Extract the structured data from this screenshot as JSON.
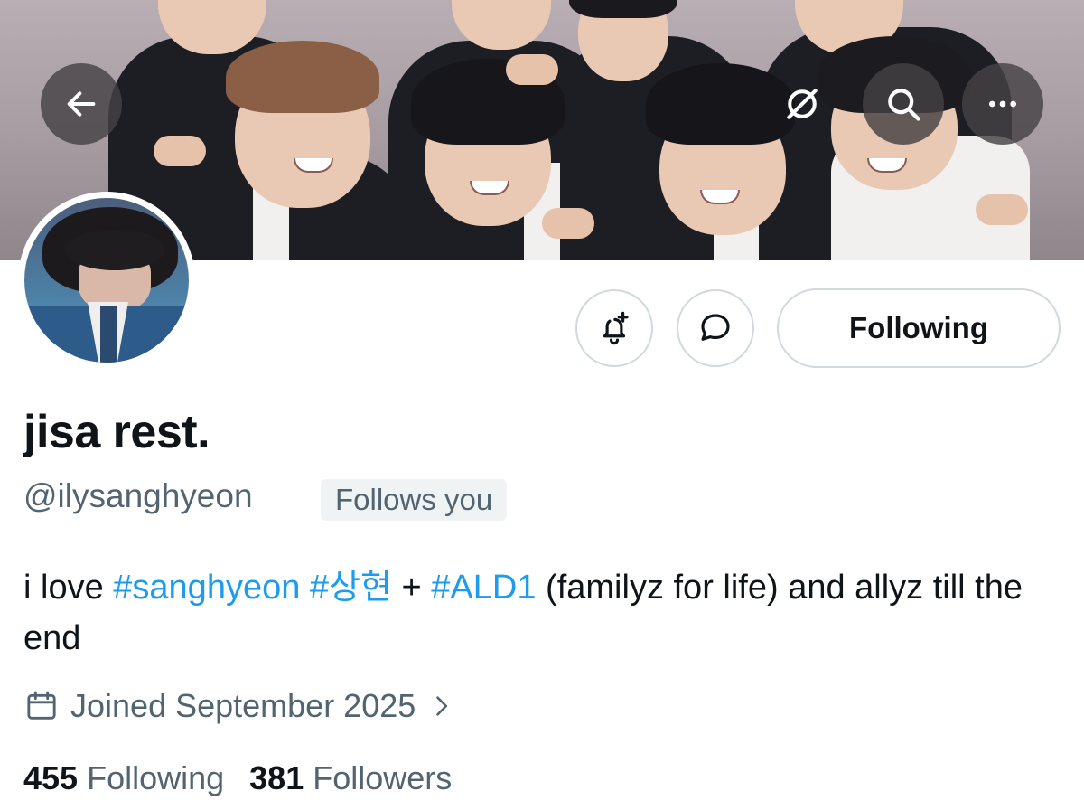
{
  "header": {
    "back_icon": "arrow-left-icon",
    "grok_icon": "slashed-circle-icon",
    "search_icon": "search-icon",
    "more_icon": "more-dots-icon"
  },
  "profile": {
    "display_name": "jisa rest.",
    "handle": "@ilysanghyeon",
    "follows_you": "Follows you",
    "bio": {
      "t1": "i love ",
      "tag1": "#sanghyeon",
      "t2": " ",
      "tag2": "#상현",
      "t3": " + ",
      "tag3": "#ALD1",
      "t4": " (familyz for life) and allyz till the end"
    },
    "joined": "Joined September 2025",
    "following_count": "455",
    "following_label": "Following",
    "followers_count": "381",
    "followers_label": "Followers"
  },
  "actions": {
    "notify_icon": "bell-plus-icon",
    "message_icon": "message-bubble-icon",
    "follow_label": "Following"
  },
  "colors": {
    "link": "#1d9bf0",
    "secondary_text": "#536471",
    "border": "#cfd9de"
  }
}
